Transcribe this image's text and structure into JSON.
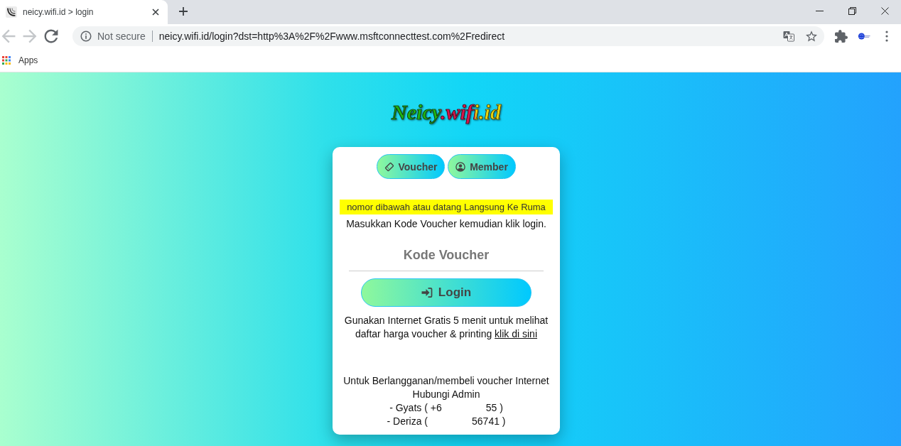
{
  "browser": {
    "tab": {
      "title": "neicy.wifi.id > login"
    },
    "navigation": [
      {
        "kind": "back",
        "disabled": true
      },
      {
        "kind": "forward",
        "disabled": true
      },
      {
        "kind": "reload",
        "disabled": false
      }
    ],
    "address_bar": {
      "security": "Not secure",
      "url": "neicy.wifi.id/login?dst=http%3A%2F%2Fwww.msftconnecttest.com%2Fredirect"
    },
    "bookmarks": [
      {
        "label": "Apps"
      }
    ]
  },
  "page": {
    "logo": "Neicy.wifi.id",
    "tabs": [
      {
        "label": "Voucher",
        "kind": "ticket"
      },
      {
        "label": "Member",
        "kind": "user"
      }
    ],
    "notice": "nomor dibawah atau datang Langsung Ke Ruma",
    "instruction": "Masukkan Kode Voucher kemudian klik login.",
    "voucher_field": {
      "placeholder": "Kode Voucher"
    },
    "login_button": "Login",
    "info": {
      "text": "Gunakan Internet Gratis 5 menit untuk melihat daftar harga voucher & printing",
      "link": "klik di sini"
    },
    "contact": {
      "lines": [
        "Untuk Berlangganan/membeli voucher Internet",
        "Hubungi Admin"
      ],
      "admins": [
        {
          "before": "- Gyats ( +6",
          "after": "55 )"
        },
        {
          "before": "- Deriza (",
          "after": "56741 )"
        }
      ]
    }
  }
}
